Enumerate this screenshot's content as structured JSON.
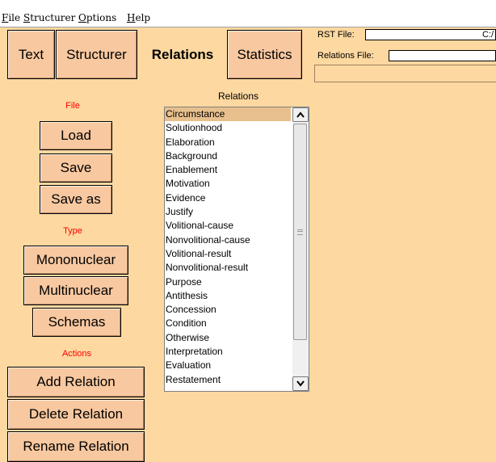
{
  "menubar": {
    "items": [
      "File",
      "Structurer",
      "Options",
      "Help"
    ]
  },
  "tabs": [
    "Text",
    "Structurer",
    "Relations",
    "Statistics"
  ],
  "files": {
    "rst_label": "RST File:",
    "rst_value": "C:/",
    "relations_label": "Relations File:",
    "relations_value": ""
  },
  "sections": {
    "file": "File",
    "type": "Type",
    "actions": "Actions"
  },
  "file_buttons": [
    "Load",
    "Save",
    "Save as"
  ],
  "type_buttons": [
    "Mononuclear",
    "Multinuclear",
    "Schemas"
  ],
  "action_buttons": [
    "Add Relation",
    "Delete Relation",
    "Rename Relation"
  ],
  "relations": {
    "title": "Relations",
    "selected": "Circumstance",
    "items": [
      "Circumstance",
      "Solutionhood",
      "Elaboration",
      "Background",
      "Enablement",
      "Motivation",
      "Evidence",
      "Justify",
      "Volitional-cause",
      "Nonvolitional-cause",
      "Volitional-result",
      "Nonvolitional-result",
      "Purpose",
      "Antithesis",
      "Concession",
      "Condition",
      "Otherwise",
      "Interpretation",
      "Evaluation",
      "Restatement"
    ]
  },
  "colors": {
    "background": "#fdd8a0",
    "button": "#f8c8a0",
    "section_label": "#ff0000",
    "selected_row": "#e8c08e"
  }
}
